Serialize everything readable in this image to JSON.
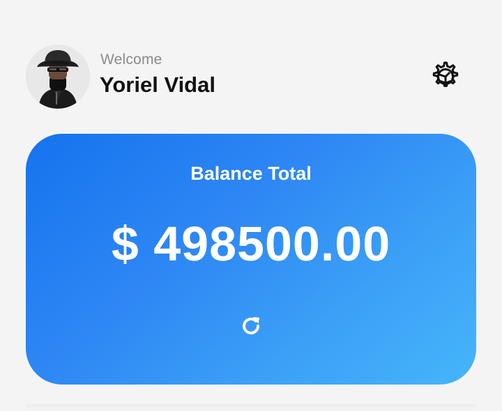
{
  "header": {
    "welcome": "Welcome",
    "user_name": "Yoriel Vidal",
    "avatar_icon": "avatar-icon",
    "settings_icon": "gear-icon"
  },
  "balance_card": {
    "title": "Balance Total",
    "amount": "$ 498500.00",
    "refresh_icon": "refresh-icon",
    "gradient_start": "#1573ee",
    "gradient_end": "#46b5fb"
  },
  "colors": {
    "background": "#f4f4f5",
    "text_primary": "#111111",
    "text_secondary": "#8b8b8b"
  }
}
